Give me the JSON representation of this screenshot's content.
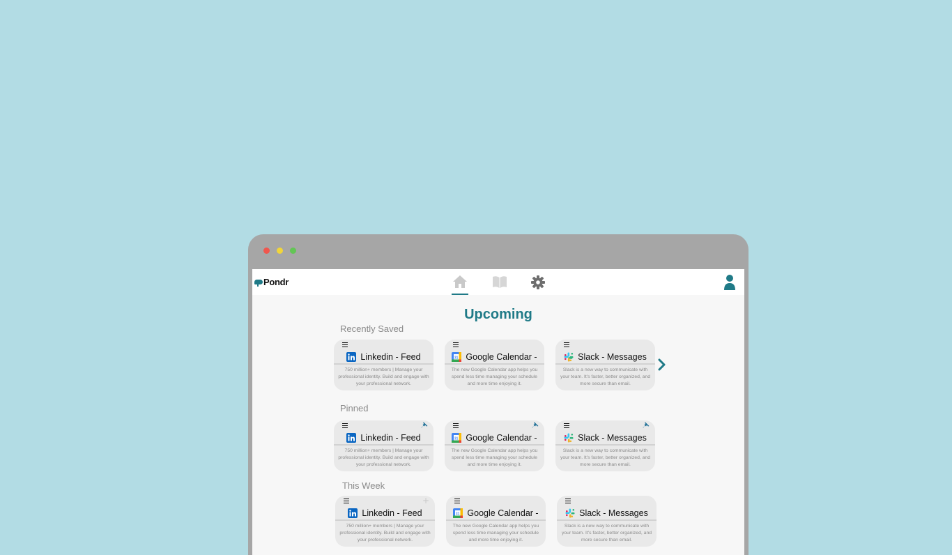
{
  "window": {
    "controls": {
      "close_color": "#f0564d",
      "minimize_color": "#f1d53a",
      "maximize_color": "#62c654"
    }
  },
  "navbar": {
    "logo_text": "Pondr",
    "items": [
      {
        "icon": "home-icon",
        "active": true
      },
      {
        "icon": "book-icon",
        "active": false
      },
      {
        "icon": "gear-icon",
        "active": false
      }
    ],
    "profile_icon": "user-icon"
  },
  "page": {
    "title": "Upcoming"
  },
  "sections": {
    "recently_saved": {
      "label": "Recently Saved",
      "cards": [
        {
          "title": "Linkedin - Feed",
          "icon": "linkedin-icon",
          "description": "750 million+ members | Manage your professional identity. Build and engage with your professional network."
        },
        {
          "title": "Google Calendar -",
          "icon": "google-calendar-icon",
          "description": "The new Google Calendar app helps you spend less time managing your schedule and more time enjoying it."
        },
        {
          "title": "Slack - Messages",
          "icon": "slack-icon",
          "description": "Slack is a new way to communicate with your team. It's faster, better organized, and more secure than email."
        }
      ]
    },
    "pinned": {
      "label": "Pinned",
      "cards": [
        {
          "title": "Linkedin - Feed",
          "icon": "linkedin-icon",
          "description": "750 million+ members | Manage your professional identity. Build and engage with your professional network."
        },
        {
          "title": "Google Calendar -",
          "icon": "google-calendar-icon",
          "description": "The new Google Calendar app helps you spend less time managing your schedule and more time enjoying it."
        },
        {
          "title": "Slack - Messages",
          "icon": "slack-icon",
          "description": "Slack is a new way to communicate with your team. It's faster, better organized, and more secure than email."
        }
      ]
    },
    "this_week": {
      "label": "This Week",
      "add_symbol": "+",
      "cards": [
        {
          "title": "Linkedin - Feed",
          "icon": "linkedin-icon",
          "description": "750 million+ members | Manage your professional identity. Build and engage with your professional network."
        },
        {
          "title": "Google Calendar -",
          "icon": "google-calendar-icon",
          "description": "The new Google Calendar app helps you spend less time managing your schedule and more time enjoying it."
        },
        {
          "title": "Slack - Messages",
          "icon": "slack-icon",
          "description": "Slack is a new way to communicate with your team. It's faster, better organized, and more secure than email."
        }
      ]
    }
  },
  "colors": {
    "background": "#b2dce4",
    "accent": "#1f7a87",
    "frame": "#a6a6a6",
    "card": "#e9e9e9",
    "muted_text": "#8a8a8a"
  }
}
